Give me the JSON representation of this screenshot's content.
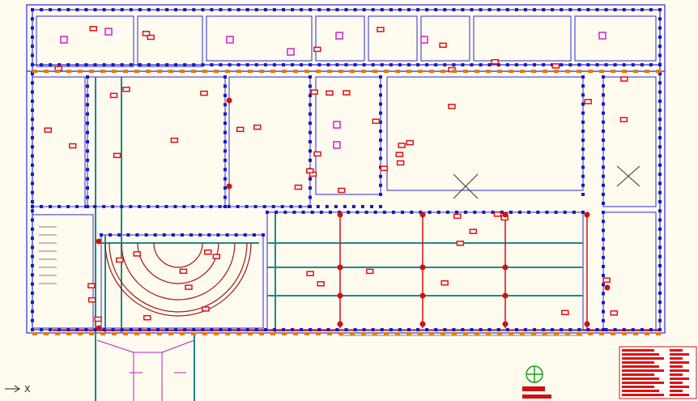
{
  "viewport": {
    "ucs_axis_label": "X",
    "background_color": "#fffbef"
  },
  "colors": {
    "wall": "#2b2bd6",
    "grid": "#1a8a8a",
    "column": "#d01010",
    "tag": "#e01010",
    "dim": "#1818c8",
    "accent_magenta": "#d020d0",
    "stair_hatch": "#808080",
    "door": "#e07a10"
  },
  "icons": [
    "ucs-icon",
    "north-compass-icon",
    "section-cross-icon"
  ],
  "title_block": {
    "visible": true,
    "rows": 12
  }
}
